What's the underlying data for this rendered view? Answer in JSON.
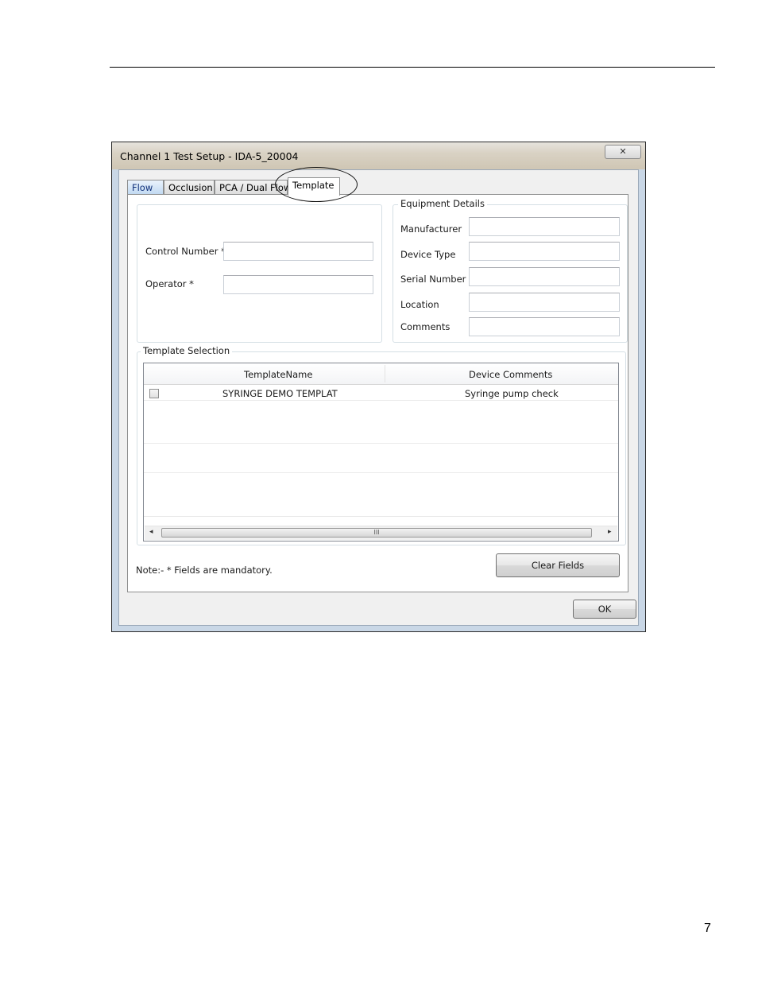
{
  "page": {
    "number": "7"
  },
  "dialog": {
    "title": "Channel 1 Test Setup - IDA-5_20004",
    "close_glyph": "✕",
    "tabs": [
      {
        "label": "Flow"
      },
      {
        "label": "Occlusion"
      },
      {
        "label": "PCA / Dual Flow"
      },
      {
        "label": "Template"
      }
    ],
    "test_info": {
      "control_number_label": "Control Number *",
      "control_number_value": "",
      "operator_label": "Operator *",
      "operator_value": ""
    },
    "equipment": {
      "legend": "Equipment Details",
      "fields": [
        {
          "label": "Manufacturer",
          "value": ""
        },
        {
          "label": "Device Type",
          "value": ""
        },
        {
          "label": "Serial Number",
          "value": ""
        },
        {
          "label": "Location",
          "value": ""
        },
        {
          "label": "Comments",
          "value": ""
        }
      ]
    },
    "template_selection": {
      "legend": "Template Selection",
      "columns": [
        "TemplateName",
        "Device Comments"
      ],
      "rows": [
        {
          "checked": false,
          "name": "SYRINGE DEMO TEMPLAT",
          "comments": "Syringe pump check"
        }
      ],
      "scroll_left": "◂",
      "scroll_right": "▸",
      "scroll_grip": "III"
    },
    "note": "Note:-  *  Fields are mandatory.",
    "clear_fields_label": "Clear Fields",
    "ok_label": "OK"
  }
}
